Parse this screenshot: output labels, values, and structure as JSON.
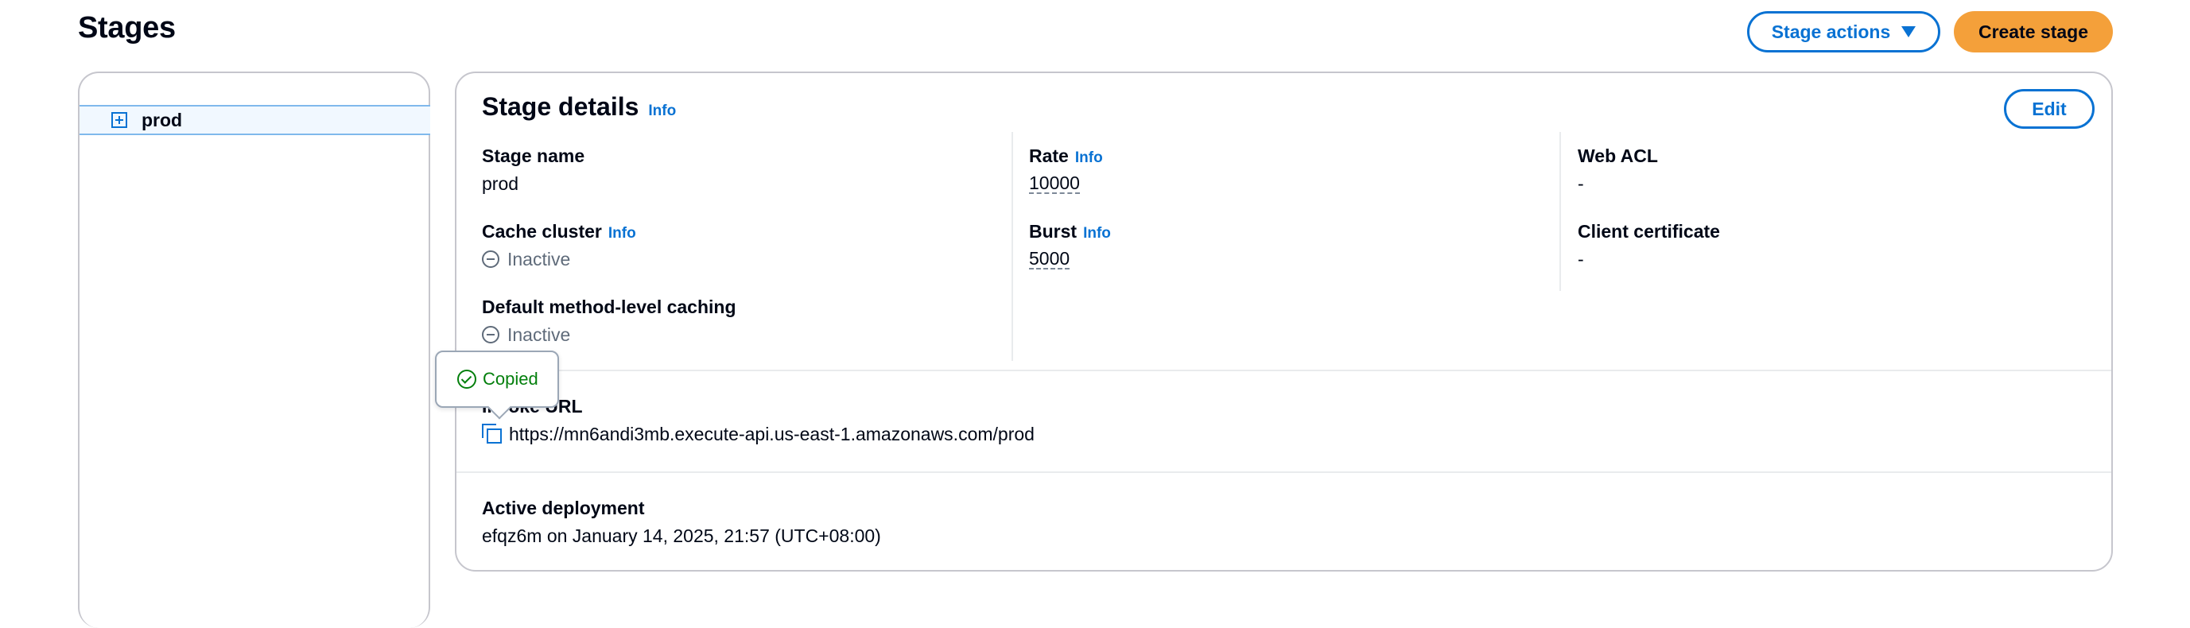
{
  "page": {
    "title": "Stages"
  },
  "header_actions": {
    "stage_actions_label": "Stage actions",
    "create_stage_label": "Create stage"
  },
  "stage_tree": {
    "items": [
      {
        "label": "prod",
        "selected": true
      }
    ]
  },
  "stage_details": {
    "title": "Stage details",
    "info_label": "Info",
    "edit_label": "Edit",
    "fields": {
      "stage_name": {
        "label": "Stage name",
        "value": "prod"
      },
      "cache_cluster": {
        "label": "Cache cluster",
        "info": "Info",
        "value": "Inactive"
      },
      "default_caching": {
        "label": "Default method-level caching",
        "value": "Inactive"
      },
      "rate": {
        "label": "Rate",
        "info": "Info",
        "value": "10000"
      },
      "burst": {
        "label": "Burst",
        "info": "Info",
        "value": "5000"
      },
      "web_acl": {
        "label": "Web ACL",
        "value": "-"
      },
      "client_certificate": {
        "label": "Client certificate",
        "value": "-"
      }
    },
    "invoke_url": {
      "label": "Invoke URL",
      "value": "https://mn6andi3mb.execute-api.us-east-1.amazonaws.com/prod"
    },
    "active_deployment": {
      "label": "Active deployment",
      "value": "efqz6m on January 14, 2025, 21:57 (UTC+08:00)"
    }
  },
  "popover": {
    "text": "Copied",
    "icon": "check-circle-icon"
  },
  "colors": {
    "link": "#0972d3",
    "primary_button": "#f4a03a",
    "success": "#037f0c",
    "muted": "#5f6b7a",
    "border": "#c6c6cd"
  }
}
